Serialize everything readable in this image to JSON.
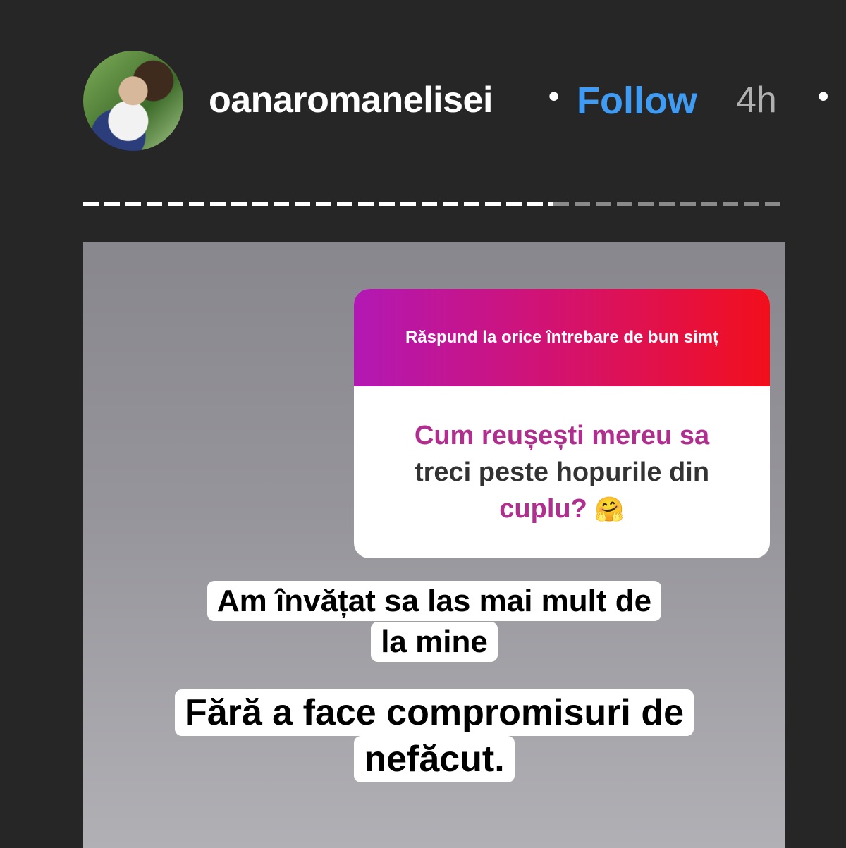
{
  "header": {
    "username": "oanaromanelisei",
    "separator": "•",
    "follow_label": "Follow",
    "time": "4h",
    "more": "•"
  },
  "story": {
    "progress_seen_fraction": 0.67,
    "question_prompt": "Răspund la orice întrebare de bun simț",
    "question_part1": "Cum reușești mereu sa",
    "question_part2": "treci peste hopurile din",
    "question_part3": "cuplu?",
    "question_emoji": "🤗",
    "answer_1": "Am învățat sa las mai mult de la mine",
    "answer_2": "Fără a face compromisuri de nefăcut."
  },
  "colors": {
    "follow": "#3f9bf3",
    "gradient_start": "#b218b4",
    "gradient_end": "#f20f1c"
  }
}
